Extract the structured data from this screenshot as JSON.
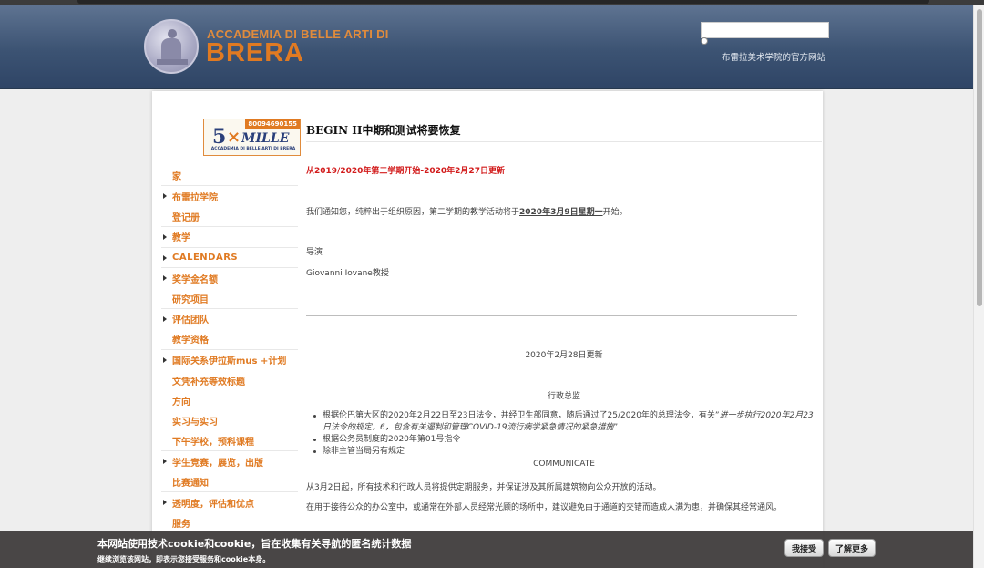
{
  "header": {
    "logo_line1": "ACCADEMIA DI BELLE ARTI DI",
    "logo_line2": "BRERA",
    "search_value": "",
    "tagline": "布雷拉美术学院的官方网站"
  },
  "banner": {
    "code": "80094690155",
    "number": "5",
    "cross": "×",
    "word": "MILLE",
    "subtitle": "ACCADEMIA DI BELLE ARTI DI BRERA"
  },
  "nav": {
    "items": [
      {
        "label": "家",
        "arrow": false
      },
      {
        "label": "布雷拉学院",
        "arrow": true
      },
      {
        "label": "登记册",
        "arrow": false
      },
      {
        "label": "教学",
        "arrow": true
      },
      {
        "label": "CALENDARS",
        "arrow": true
      },
      {
        "label": "奖学金名额",
        "arrow": true
      },
      {
        "label": "研究项目",
        "arrow": false
      },
      {
        "label": "评估团队",
        "arrow": true
      },
      {
        "label": "教学资格",
        "arrow": false
      },
      {
        "label": "国际关系伊拉斯mus +计划",
        "arrow": true
      },
      {
        "label": "文凭补充等效标题",
        "arrow": false
      },
      {
        "label": "方向",
        "arrow": false
      },
      {
        "label": "实习与实习",
        "arrow": false
      },
      {
        "label": "下午学校，预科课程",
        "arrow": false
      },
      {
        "label": "学生竞赛，展览，出版",
        "arrow": true
      },
      {
        "label": "比赛通知",
        "arrow": false
      },
      {
        "label": "透明度，评估和优点",
        "arrow": true
      },
      {
        "label": "服务",
        "arrow": false
      }
    ]
  },
  "article": {
    "title": "BEGIN II中期和测试将要恢复",
    "red_update": "从2019/2020年第二学期开始-2020年2月27日更新",
    "p1_before": "我们通知您，纯粹出于组织原因，第二学期的教学活动将于",
    "p1_date": "2020年3月9日星期一",
    "p1_after": "开始。",
    "director_label": "导演",
    "director_name": "Giovanni Iovane教授",
    "update2": "2020年2月28日更新",
    "admin": "行政总监",
    "bullet1_text": "根据伦巴第大区的2020年2月22日至23日法令，并经卫生部同意，随后通过了25/2020年的总理法令，有关”",
    "bullet1_em": "进一步执行2020年2月23日法令的规定，6，包含有关遏制和管理COVID-19流行病学紧急情况的紧急措施",
    "bullet1_end": "”",
    "bullet2": "根据公务员制度的2020年第01号指令",
    "bullet3": "除非主管当局另有规定",
    "communicate": "COMMUNICATE",
    "p2": "从3月2日起，所有技术和行政人员将提供定期服务，并保证涉及其所属建筑物向公众开放的活动。",
    "p3": "在用于接待公众的办公室中，或通常在外部人员经常光顾的场所中，建议避免由于通道的交错而造成人满为患，并确保其经常通风。"
  },
  "cookie": {
    "title": "本网站使用技术cookie和cookie，旨在收集有关导航的匿名统计数据",
    "subtitle": "继续浏览该网站，即表示您接受服务和cookie本身。",
    "accept": "我接受",
    "learn_more": "了解更多"
  }
}
